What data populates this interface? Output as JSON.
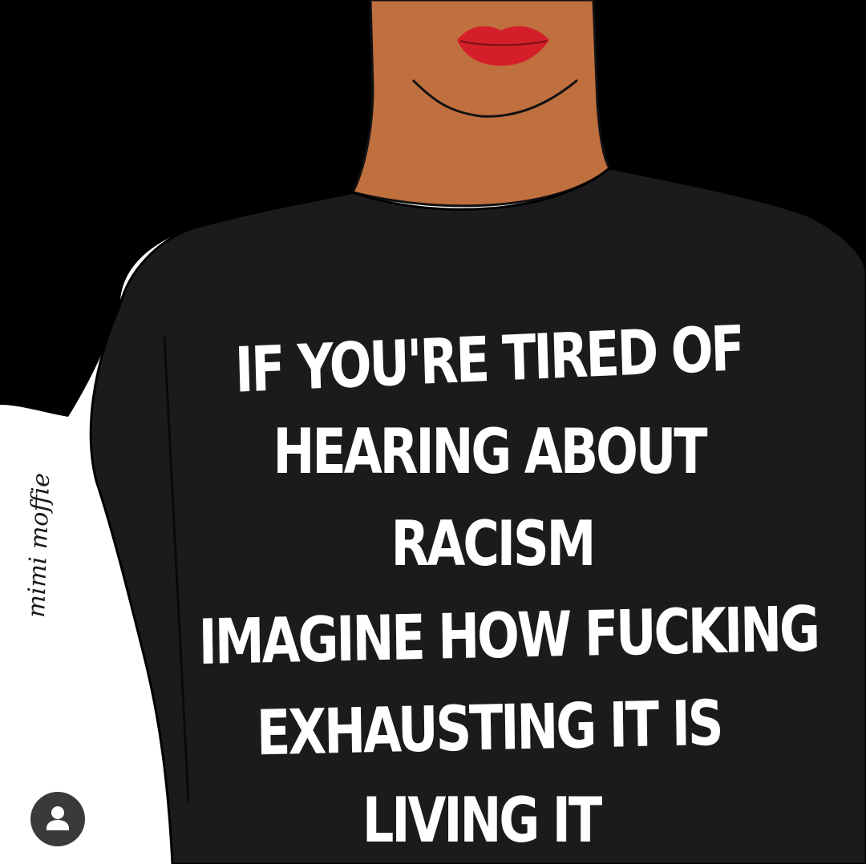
{
  "colors": {
    "hair": "#000000",
    "skin": "#c06f3f",
    "skin_shadow": "#a85c32",
    "lips": "#d41f2b",
    "shirt": "#1b1b1b",
    "text": "#ffffff",
    "background": "#ffffff"
  },
  "shirt": {
    "lines": [
      "IF YOU'RE TIRED OF",
      "HEARING ABOUT",
      "RACISM",
      "IMAGINE HOW FUCKING",
      "EXHAUSTING IT IS",
      "LIVING IT"
    ]
  },
  "signature": {
    "text": "mimi moffie"
  },
  "overlay": {
    "icon": "user-profile-icon"
  }
}
